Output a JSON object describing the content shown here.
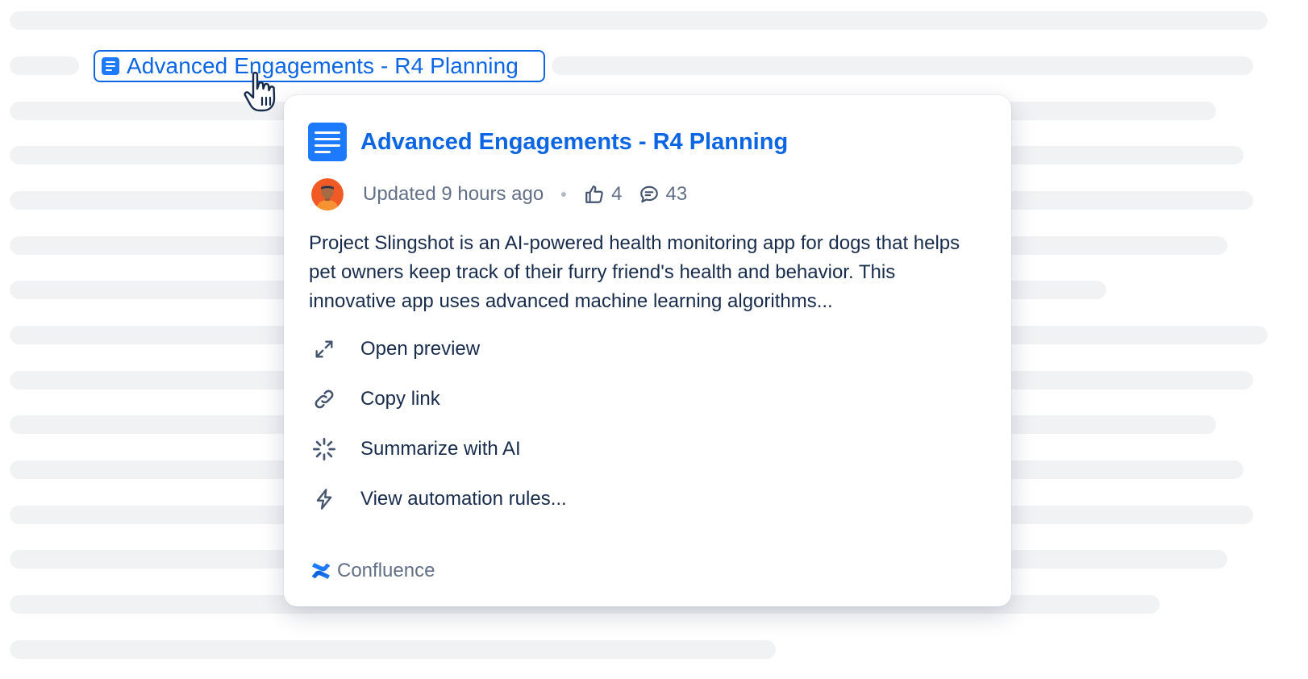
{
  "inline_link": {
    "title": "Advanced Engagements - R4 Planning"
  },
  "hover_card": {
    "title": "Advanced Engagements - R4 Planning",
    "updated": "Updated 9 hours ago",
    "likes": "4",
    "comments": "43",
    "summary": "Project Slingshot is an AI-powered health monitoring app for dogs that helps pet owners keep track of their furry friend's health and behavior. This innovative app uses advanced machine learning algorithms...",
    "actions": [
      {
        "label": "Open preview",
        "icon": "expand-icon"
      },
      {
        "label": "Copy link",
        "icon": "link-icon"
      },
      {
        "label": "Summarize with AI",
        "icon": "ai-sparkle-icon"
      },
      {
        "label": "View automation rules...",
        "icon": "lightning-icon"
      }
    ],
    "provider": "Confluence"
  },
  "colors": {
    "link_blue": "#0c66e4",
    "icon_blue": "#1d7afc",
    "text_primary": "#172b4d",
    "text_subtle": "#626f86",
    "skeleton": "#f1f2f4"
  }
}
